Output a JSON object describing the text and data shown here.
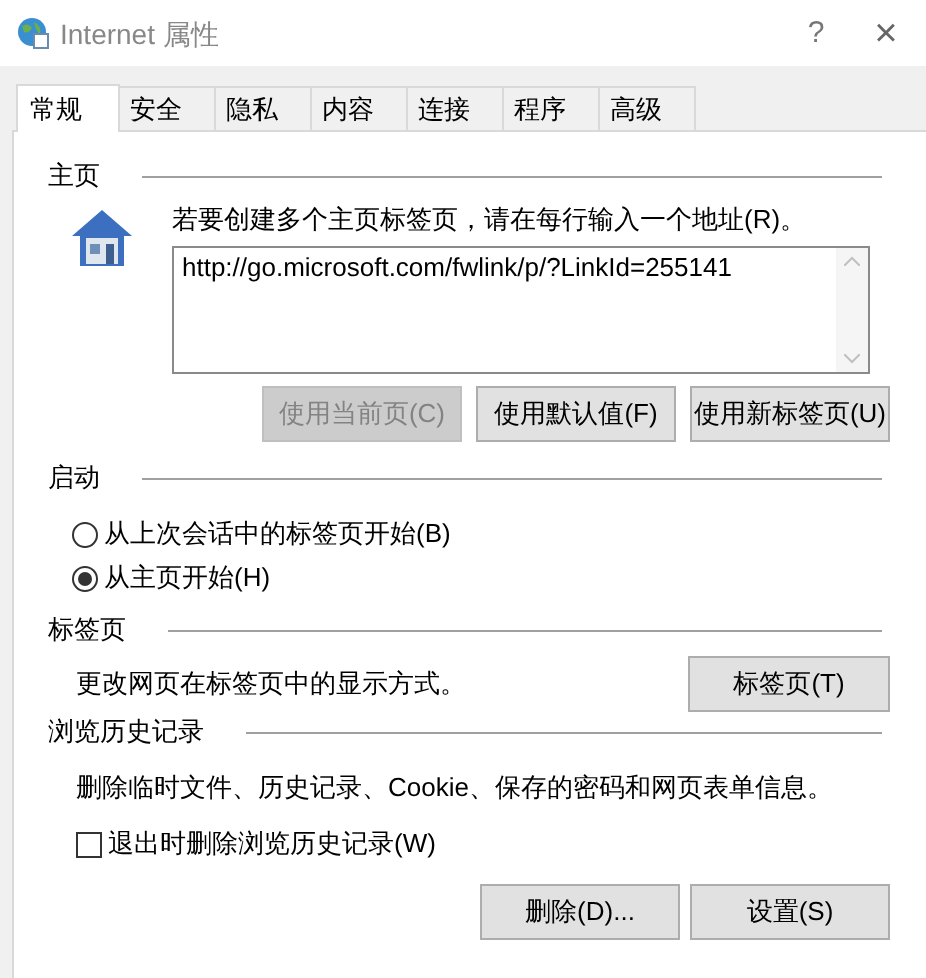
{
  "window": {
    "title": "Internet 属性",
    "help": "?",
    "close": "×"
  },
  "tabs": [
    {
      "label": "常规",
      "selected": true
    },
    {
      "label": "安全",
      "selected": false
    },
    {
      "label": "隐私",
      "selected": false
    },
    {
      "label": "内容",
      "selected": false
    },
    {
      "label": "连接",
      "selected": false
    },
    {
      "label": "程序",
      "selected": false
    },
    {
      "label": "高级",
      "selected": false
    }
  ],
  "home_page": {
    "heading": "主页",
    "instruction": "若要创建多个主页标签页，请在每行输入一个地址(R)。",
    "value": "http://go.microsoft.com/fwlink/p/?LinkId=255141",
    "buttons": [
      {
        "label": "使用当前页(C)",
        "disabled": true
      },
      {
        "label": "使用默认值(F)",
        "disabled": false
      },
      {
        "label": "使用新标签页(U)",
        "disabled": false
      }
    ]
  },
  "startup": {
    "heading": "启动",
    "options": [
      {
        "label": "从上次会话中的标签页开始(B)",
        "selected": false
      },
      {
        "label": "从主页开始(H)",
        "selected": true
      }
    ]
  },
  "tabs_section": {
    "heading": "标签页",
    "description": "更改网页在标签页中的显示方式。",
    "button": "标签页(T)"
  },
  "history": {
    "heading": "浏览历史记录",
    "description": "删除临时文件、历史记录、Cookie、保存的密码和网页表单信息。",
    "checkbox": {
      "label": "退出时删除浏览历史记录(W)",
      "checked": false
    },
    "buttons": [
      {
        "label": "删除(D)..."
      },
      {
        "label": "设置(S)"
      }
    ]
  }
}
